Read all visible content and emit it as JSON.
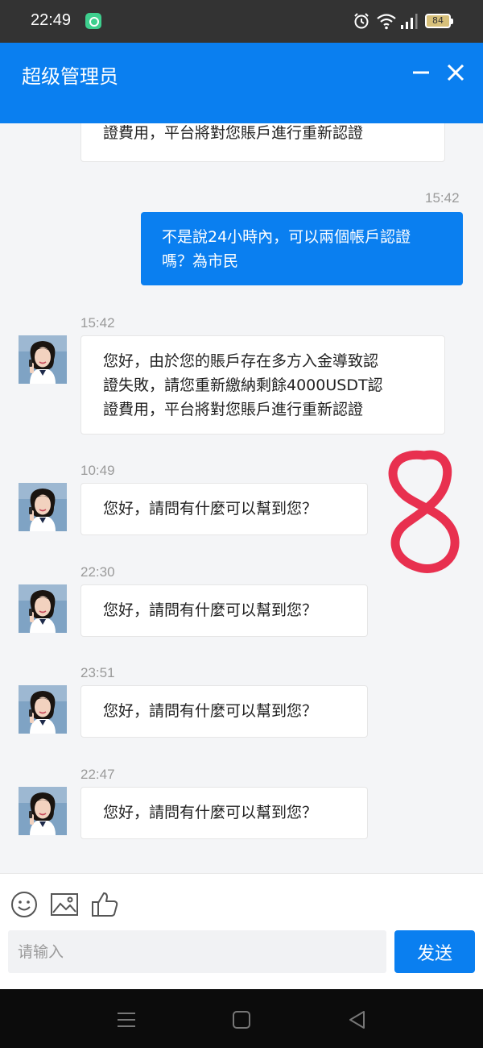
{
  "status_bar": {
    "time": "22:49",
    "battery": "84",
    "icons": [
      "app-notification-icon",
      "alarm-icon",
      "wifi-icon",
      "signal-icon",
      "battery-icon"
    ]
  },
  "header": {
    "title": "超级管理员",
    "icons": [
      "minimize-icon",
      "close-icon"
    ]
  },
  "messages": [
    {
      "side": "in",
      "avatar": false,
      "time": "",
      "lines": [
        "證費用，平台將對您賬戶進行重新認證"
      ]
    },
    {
      "side": "out",
      "time": "15:42",
      "lines": [
        "不是說24小時內，可以兩個帳戶認證",
        "嗎？為市民"
      ]
    },
    {
      "side": "in",
      "avatar": true,
      "time": "15:42",
      "lines": [
        "您好，由於您的賬戶存在多方入金導致認",
        "證失敗，請您重新繳納剩餘4000USDT認",
        "證費用，平台將對您賬戶進行重新認證"
      ]
    },
    {
      "side": "in",
      "avatar": true,
      "time": "10:49",
      "lines": [
        "您好，請問有什麼可以幫到您？"
      ]
    },
    {
      "side": "in",
      "avatar": true,
      "time": "22:30",
      "lines": [
        "您好，請問有什麼可以幫到您？"
      ]
    },
    {
      "side": "in",
      "avatar": true,
      "time": "23:51",
      "lines": [
        "您好，請問有什麼可以幫到您？"
      ]
    },
    {
      "side": "in",
      "avatar": true,
      "time": "22:47",
      "lines": [
        "您好，請問有什麼可以幫到您？"
      ]
    }
  ],
  "annotation": {
    "handwritten_mark": "8",
    "color": "#e8304f"
  },
  "toolbar": {
    "icons": [
      "emoji-icon",
      "image-icon",
      "thumbs-up-icon"
    ]
  },
  "composer": {
    "placeholder": "请输入",
    "value": "",
    "send_label": "发送"
  },
  "colors": {
    "accent": "#0a7ff0",
    "status_bar": "#333333",
    "background": "#f4f5f7"
  },
  "nav_bar": {
    "icons": [
      "menu-icon",
      "home-icon",
      "back-icon"
    ]
  }
}
